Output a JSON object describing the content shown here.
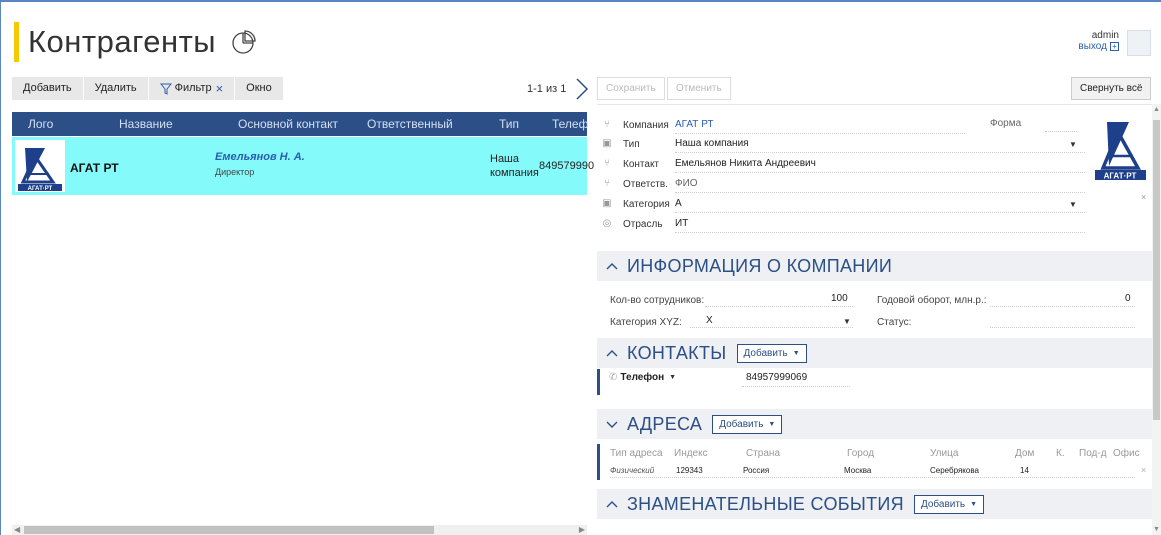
{
  "header": {
    "title": "Контрагенты",
    "user": "admin",
    "logout": "выход"
  },
  "toolbar": {
    "add": "Добавить",
    "delete": "Удалить",
    "filter": "Фильтр",
    "window": "Окно",
    "pager": "1-1 из 1"
  },
  "table": {
    "columns": [
      "Лого",
      "Название",
      "Основной контакт",
      "Ответственный",
      "Тип",
      "Телеф"
    ],
    "row": {
      "name": "АГАТ РТ",
      "contact": "Емельянов Н. А.",
      "role": "Директор",
      "type_line1": "Наша",
      "type_line2": "компания",
      "phone": "849579990"
    }
  },
  "details": {
    "save": "Сохранить",
    "cancel": "Отменить",
    "collapse_all": "Свернуть всё",
    "fields": {
      "company_label": "Компания",
      "company_value": "АГАТ РТ",
      "form_label": "Форма",
      "type_label": "Тип",
      "type_value": "Наша компания",
      "contact_label": "Контакт",
      "contact_value": "Емельянов Никита Андреевич",
      "responsible_label": "Ответств.",
      "responsible_value": "ФИО",
      "category_label": "Категория",
      "category_value": "А",
      "industry_label": "Отрасль",
      "industry_value": "ИТ"
    },
    "company_info": {
      "title": "ИНФОРМАЦИЯ О КОМПАНИИ",
      "employees_label": "Кол-во сотрудников:",
      "employees_value": "100",
      "turnover_label": "Годовой оборот, млн.р.:",
      "turnover_value": "0",
      "xyz_label": "Категория XYZ:",
      "xyz_value": "X",
      "status_label": "Статус:"
    },
    "contacts": {
      "title": "КОНТАКТЫ",
      "add": "Добавить",
      "phone_label": "Телефон",
      "phone_value": "84957999069"
    },
    "addresses": {
      "title": "АДРЕСА",
      "add": "Добавить",
      "headers": [
        "Тип адреса",
        "Индекс",
        "Страна",
        "Город",
        "Улица",
        "Дом",
        "К.",
        "Под-д",
        "Офис"
      ],
      "row": {
        "type": "Физический",
        "index": "129343",
        "country": "Россия",
        "city": "Москва",
        "street": "Серебрякова",
        "house": "14"
      }
    },
    "events": {
      "title": "ЗНАМЕНАТЕЛЬНЫЕ СОБЫТИЯ",
      "add": "Добавить"
    }
  },
  "logo": {
    "brand": "АГАТ·РТ"
  },
  "colors": {
    "header_blue": "#2b4f86",
    "row_highlight": "#85fafa",
    "accent_yellow": "#f5c800"
  }
}
